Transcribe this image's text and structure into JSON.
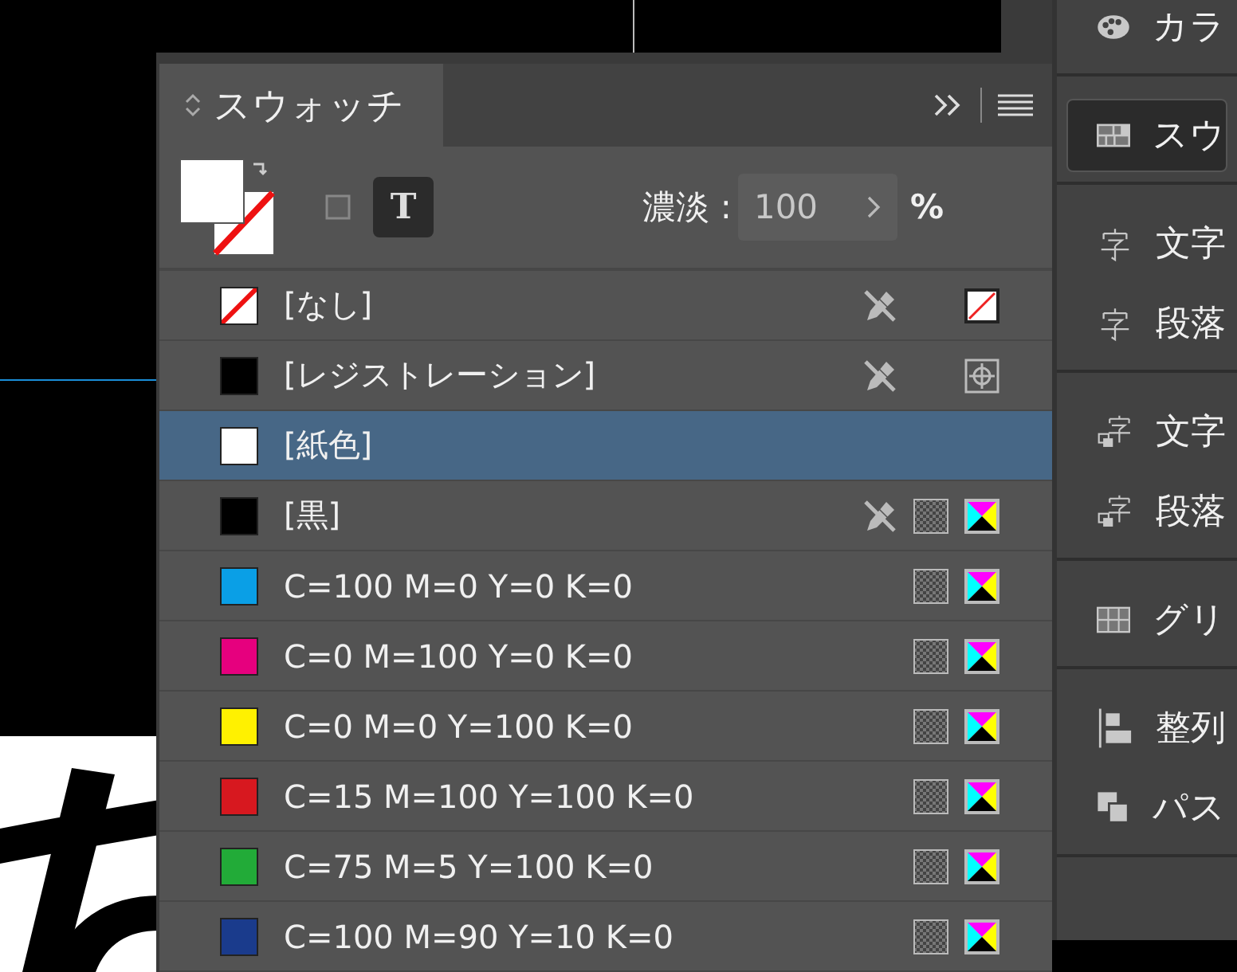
{
  "panel": {
    "tab": {
      "label": "スウォッチ"
    },
    "text_button": {
      "label": "T"
    },
    "tint": {
      "label": "濃淡 :",
      "value": "100",
      "unit": "%"
    },
    "swatches": [
      {
        "name": "[なし]",
        "kind": "none",
        "color": "#ffffff",
        "locked": true,
        "selected": false
      },
      {
        "name": "[レジストレーション]",
        "kind": "registration",
        "color": "#000000",
        "locked": true,
        "selected": false
      },
      {
        "name": "[紙色]",
        "kind": "paper",
        "color": "#ffffff",
        "locked": false,
        "selected": true
      },
      {
        "name": "[黒]",
        "kind": "process",
        "color": "#000000",
        "locked": true,
        "selected": false
      },
      {
        "name": "C=100 M=0 Y=0 K=0",
        "kind": "process",
        "color": "#0a9fe6",
        "locked": false,
        "selected": false
      },
      {
        "name": "C=0 M=100 Y=0 K=0",
        "kind": "process",
        "color": "#e6007e",
        "locked": false,
        "selected": false
      },
      {
        "name": "C=0 M=0 Y=100 K=0",
        "kind": "process",
        "color": "#fff100",
        "locked": false,
        "selected": false
      },
      {
        "name": "C=15 M=100 Y=100 K=0",
        "kind": "process",
        "color": "#d7181f",
        "locked": false,
        "selected": false
      },
      {
        "name": "C=75 M=5 Y=100 K=0",
        "kind": "process",
        "color": "#22ab38",
        "locked": false,
        "selected": false
      },
      {
        "name": "C=100 M=90 Y=10 K=0",
        "kind": "process",
        "color": "#1a3b8c",
        "locked": false,
        "selected": false
      }
    ]
  },
  "dock": {
    "groups": [
      {
        "items": [
          {
            "label": "カラ",
            "kind": "palette",
            "selected": false
          }
        ]
      },
      {
        "items": [
          {
            "label": "スウ",
            "kind": "swatches",
            "selected": true
          }
        ]
      },
      {
        "items": [
          {
            "label": "文字",
            "kind": "char",
            "selected": false
          },
          {
            "label": "段落",
            "kind": "para",
            "selected": false
          }
        ]
      },
      {
        "items": [
          {
            "label": "文字",
            "kind": "char-style",
            "selected": false
          },
          {
            "label": "段落",
            "kind": "para-style",
            "selected": false
          }
        ]
      },
      {
        "items": [
          {
            "label": "グリ",
            "kind": "grid",
            "selected": false
          }
        ]
      },
      {
        "items": [
          {
            "label": "整列",
            "kind": "align",
            "selected": false
          },
          {
            "label": "パス",
            "kind": "pathfinder",
            "selected": false
          }
        ]
      }
    ]
  }
}
